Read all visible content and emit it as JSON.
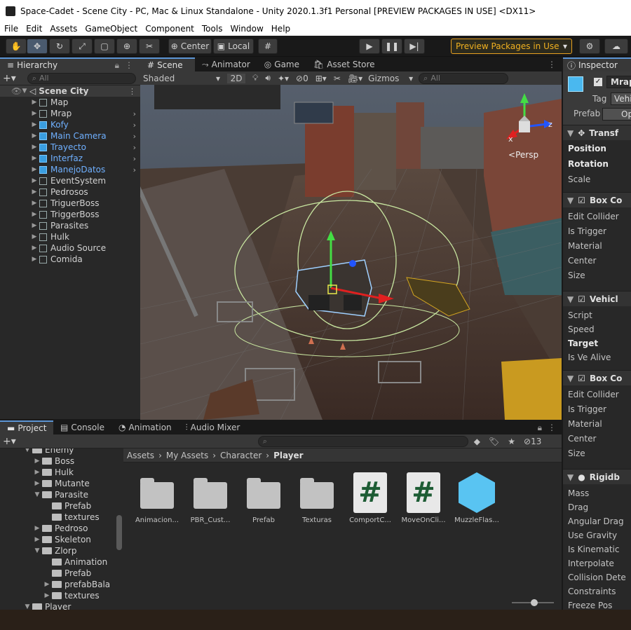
{
  "window": {
    "title": "Space-Cadet - Scene City - PC, Mac & Linux Standalone - Unity 2020.1.3f1 Personal [PREVIEW PACKAGES IN USE] <DX11>"
  },
  "menu": [
    "File",
    "Edit",
    "Assets",
    "GameObject",
    "Component",
    "Tools",
    "Window",
    "Help"
  ],
  "toolbar": {
    "center_label": "Center",
    "local_label": "Local",
    "preview_label": "Preview Packages in Use"
  },
  "hierarchy": {
    "tab": "Hierarchy",
    "search_placeholder": "All",
    "scene": "Scene City",
    "items": [
      {
        "label": "Map",
        "blue": false
      },
      {
        "label": "Mrap",
        "blue": false
      },
      {
        "label": "Kofy",
        "blue": true
      },
      {
        "label": "Main Camera",
        "blue": true
      },
      {
        "label": "Trayecto",
        "blue": true
      },
      {
        "label": "Interfaz",
        "blue": true
      },
      {
        "label": "ManejoDatos",
        "blue": true
      },
      {
        "label": "EventSystem",
        "blue": false
      },
      {
        "label": "Pedrosos",
        "blue": false
      },
      {
        "label": "TriguerBoss",
        "blue": false
      },
      {
        "label": "TriggerBoss",
        "blue": false
      },
      {
        "label": "Parasites",
        "blue": false
      },
      {
        "label": "Hulk",
        "blue": false
      },
      {
        "label": "Audio Source",
        "blue": false
      },
      {
        "label": "Comida",
        "blue": false
      }
    ]
  },
  "scene_view": {
    "tabs": [
      "Scene",
      "Animator",
      "Game",
      "Asset Store"
    ],
    "shading": "Shaded",
    "mode_2d": "2D",
    "hidden_count": "0",
    "gizmos": "Gizmos",
    "search_placeholder": "All",
    "persp": "Persp",
    "axis_x": "x",
    "axis_z": "z",
    "axis_y": "y"
  },
  "inspector": {
    "tab": "Inspector",
    "object_name": "Mrap",
    "tag_label": "Tag",
    "tag_value": "Vehi",
    "prefab_label": "Prefab",
    "prefab_open": "Op",
    "transform": {
      "header": "Transf",
      "rows": [
        "Position",
        "Rotation",
        "Scale"
      ]
    },
    "box_collider_1": {
      "header": "Box Co",
      "rows": [
        "Edit Collider",
        "Is Trigger",
        "Material",
        "Center",
        "Size"
      ]
    },
    "vehicle": {
      "header": "Vehicl",
      "rows": [
        "Script",
        "Speed",
        "Target",
        "Is Ve Alive"
      ]
    },
    "box_collider_2": {
      "header": "Box Co",
      "rows": [
        "Edit Collider",
        "Is Trigger",
        "Material",
        "Center",
        "Size"
      ]
    },
    "rigidbody": {
      "header": "Rigidb",
      "rows": [
        "Mass",
        "Drag",
        "Angular Drag",
        "Use Gravity",
        "Is Kinematic",
        "Interpolate",
        "Collision Dete",
        "Constraints",
        "Freeze Pos"
      ]
    }
  },
  "project": {
    "tabs": [
      "Project",
      "Console",
      "Animation",
      "Audio Mixer"
    ],
    "hidden_count": "13",
    "breadcrumb": [
      "Assets",
      "My Assets",
      "Character",
      "Player"
    ],
    "tree": [
      {
        "label": "Enemy",
        "level": 2,
        "open": true
      },
      {
        "label": "Boss",
        "level": 3,
        "open": false
      },
      {
        "label": "Hulk",
        "level": 3,
        "open": false
      },
      {
        "label": "Mutante",
        "level": 3,
        "open": false
      },
      {
        "label": "Parasite",
        "level": 3,
        "open": true
      },
      {
        "label": "Prefab",
        "level": 4,
        "open": null
      },
      {
        "label": "textures",
        "level": 4,
        "open": null
      },
      {
        "label": "Pedroso",
        "level": 3,
        "open": false
      },
      {
        "label": "Skeleton",
        "level": 3,
        "open": false
      },
      {
        "label": "Zlorp",
        "level": 3,
        "open": true
      },
      {
        "label": "Animation",
        "level": 4,
        "open": null
      },
      {
        "label": "Prefab",
        "level": 4,
        "open": null
      },
      {
        "label": "prefabBala",
        "level": 4,
        "open": false
      },
      {
        "label": "textures",
        "level": 4,
        "open": false
      },
      {
        "label": "Player",
        "level": 2,
        "open": true
      }
    ],
    "assets": [
      {
        "label": "Animacion...",
        "kind": "folder"
      },
      {
        "label": "PBR_Cust...",
        "kind": "folder"
      },
      {
        "label": "Prefab",
        "kind": "folder"
      },
      {
        "label": "Texturas",
        "kind": "folder"
      },
      {
        "label": "ComportC...",
        "kind": "script"
      },
      {
        "label": "MoveOnCli...",
        "kind": "script"
      },
      {
        "label": "MuzzleFlas...",
        "kind": "prefab"
      }
    ]
  }
}
